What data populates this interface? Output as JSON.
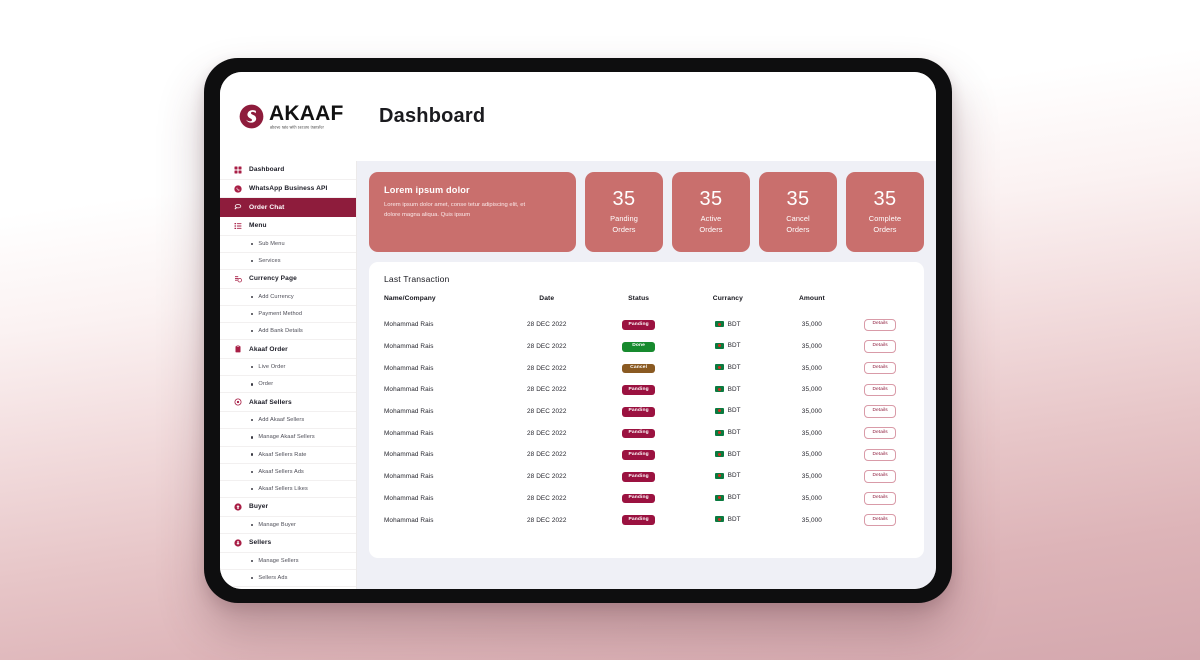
{
  "brand": {
    "name": "AKAAF",
    "tagline": "above rate with secure transfer",
    "logo_icon": "akaaf-swirl-logo"
  },
  "header": {
    "title": "Dashboard"
  },
  "colors": {
    "brand_maroon": "#8e1c3c",
    "accent_red": "#a81e45",
    "card_rose": "#c96f6d",
    "content_bg": "#eff0f6",
    "status_panding": "#9b1240",
    "status_done": "#178a2e",
    "status_cancel": "#8a5a22"
  },
  "sidebar": {
    "items": [
      {
        "label": "Dashboard",
        "icon": "grid-icon",
        "type": "main",
        "active": false
      },
      {
        "label": "WhatsApp Business API",
        "icon": "whatsapp-icon",
        "type": "main",
        "active": false
      },
      {
        "label": "Order Chat",
        "icon": "chat-icon",
        "type": "main",
        "active": true
      },
      {
        "label": "Menu",
        "icon": "list-icon",
        "type": "main",
        "active": false
      },
      {
        "label": "Sub Menu",
        "type": "sub"
      },
      {
        "label": "Services",
        "type": "sub"
      },
      {
        "label": "Currency Page",
        "icon": "currency-icon",
        "type": "main",
        "active": false
      },
      {
        "label": "Add Currency",
        "type": "sub"
      },
      {
        "label": "Payment Method",
        "type": "sub"
      },
      {
        "label": "Add Bank Details",
        "type": "sub"
      },
      {
        "label": "Akaaf Order",
        "icon": "clipboard-icon",
        "type": "main",
        "active": false
      },
      {
        "label": "Live Order",
        "type": "sub"
      },
      {
        "label": "Order",
        "type": "sub"
      },
      {
        "label": "Akaaf Sellers",
        "icon": "target-icon",
        "type": "main",
        "active": false
      },
      {
        "label": "Add Akaaf Sellers",
        "type": "sub"
      },
      {
        "label": "Manage Akaaf Sellers",
        "type": "sub"
      },
      {
        "label": "Akaaf Sellers Rate",
        "type": "sub"
      },
      {
        "label": "Akaaf Sellers Ads",
        "type": "sub"
      },
      {
        "label": "Akaaf Sellers Likes",
        "type": "sub"
      },
      {
        "label": "Buyer",
        "icon": "arrow-up-circle-icon",
        "type": "main",
        "active": false
      },
      {
        "label": "Manage Buyer",
        "type": "sub"
      },
      {
        "label": "Sellers",
        "icon": "arrow-down-circle-icon",
        "type": "main",
        "active": false
      },
      {
        "label": "Manage Sellers",
        "type": "sub"
      },
      {
        "label": "Sellers Ads",
        "type": "sub"
      }
    ]
  },
  "cards": {
    "promo": {
      "title": "Lorem ipsum dolor",
      "body": "Lorem ipsum dolor amet, conse tetur adipiscing elit, et dolore magna aliqua. Quis ipsum"
    },
    "stats": [
      {
        "value": "35",
        "line1": "Panding",
        "line2": "Orders"
      },
      {
        "value": "35",
        "line1": "Active",
        "line2": "Orders"
      },
      {
        "value": "35",
        "line1": "Cancel",
        "line2": "Orders"
      },
      {
        "value": "35",
        "line1": "Complete",
        "line2": "Orders"
      }
    ]
  },
  "transactions": {
    "title": "Last Transaction",
    "columns": [
      "Name/Company",
      "Date",
      "Status",
      "Currancy",
      "Amount",
      ""
    ],
    "action_label": "Details",
    "rows": [
      {
        "name": "Mohammad Rais",
        "date": "28 DEC 2022",
        "status": "Panding",
        "status_kind": "panding",
        "currency": "BDT",
        "currency_flag": "bangladesh-flag-icon",
        "amount": "35,000",
        "action": "Details"
      },
      {
        "name": "Mohammad Rais",
        "date": "28 DEC 2022",
        "status": "Done",
        "status_kind": "done",
        "currency": "BDT",
        "currency_flag": "bangladesh-flag-icon",
        "amount": "35,000",
        "action": "Details"
      },
      {
        "name": "Mohammad Rais",
        "date": "28 DEC 2022",
        "status": "Cancel",
        "status_kind": "cancel",
        "currency": "BDT",
        "currency_flag": "bangladesh-flag-icon",
        "amount": "35,000",
        "action": "Details"
      },
      {
        "name": "Mohammad Rais",
        "date": "28 DEC 2022",
        "status": "Panding",
        "status_kind": "panding",
        "currency": "BDT",
        "currency_flag": "bangladesh-flag-icon",
        "amount": "35,000",
        "action": "Details"
      },
      {
        "name": "Mohammad Rais",
        "date": "28 DEC 2022",
        "status": "Panding",
        "status_kind": "panding",
        "currency": "BDT",
        "currency_flag": "bangladesh-flag-icon",
        "amount": "35,000",
        "action": "Details"
      },
      {
        "name": "Mohammad Rais",
        "date": "28 DEC 2022",
        "status": "Panding",
        "status_kind": "panding",
        "currency": "BDT",
        "currency_flag": "bangladesh-flag-icon",
        "amount": "35,000",
        "action": "Details"
      },
      {
        "name": "Mohammad Rais",
        "date": "28 DEC 2022",
        "status": "Panding",
        "status_kind": "panding",
        "currency": "BDT",
        "currency_flag": "bangladesh-flag-icon",
        "amount": "35,000",
        "action": "Details"
      },
      {
        "name": "Mohammad Rais",
        "date": "28 DEC 2022",
        "status": "Panding",
        "status_kind": "panding",
        "currency": "BDT",
        "currency_flag": "bangladesh-flag-icon",
        "amount": "35,000",
        "action": "Details"
      },
      {
        "name": "Mohammad Rais",
        "date": "28 DEC 2022",
        "status": "Panding",
        "status_kind": "panding",
        "currency": "BDT",
        "currency_flag": "bangladesh-flag-icon",
        "amount": "35,000",
        "action": "Details"
      },
      {
        "name": "Mohammad Rais",
        "date": "28 DEC 2022",
        "status": "Panding",
        "status_kind": "panding",
        "currency": "BDT",
        "currency_flag": "bangladesh-flag-icon",
        "amount": "35,000",
        "action": "Details"
      }
    ]
  }
}
